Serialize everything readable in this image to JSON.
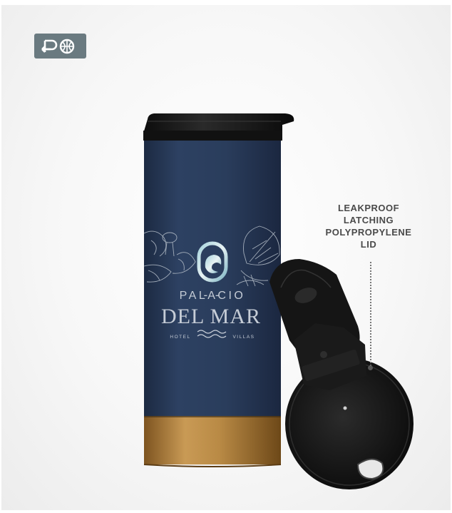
{
  "badge": {
    "icon": "po-logo-icon",
    "text": "PO"
  },
  "callout": {
    "lines": [
      "LEAKPROOF",
      "LATCHING",
      "POLYPROPYLENE",
      "LID"
    ]
  },
  "tumbler": {
    "body_color": "#283a57",
    "base_color": "#b3823e",
    "lid_color": "#151515",
    "brand": {
      "line1": "PALACIO",
      "line2": "DEL MAR",
      "left_word": "HOTEL",
      "right_word": "VILLAS"
    }
  }
}
